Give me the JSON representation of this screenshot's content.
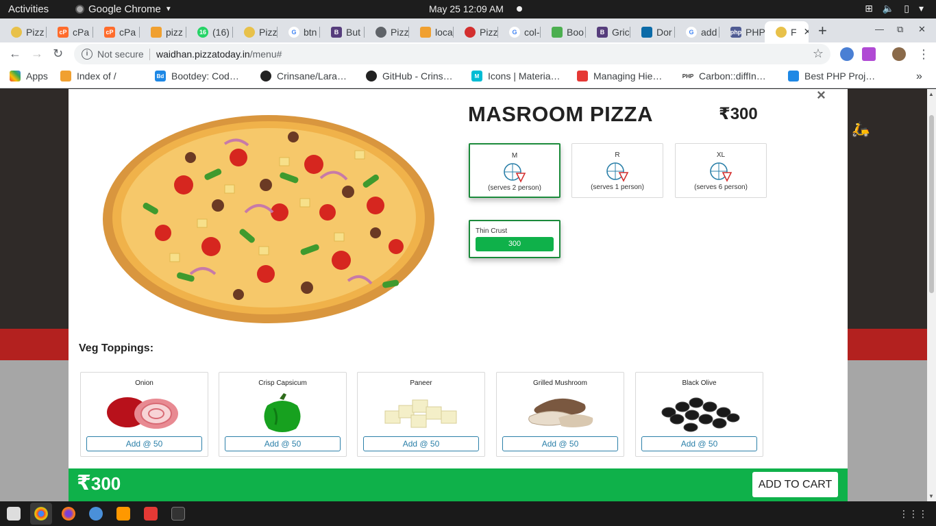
{
  "topbar": {
    "activities": "Activities",
    "app_name": "Google Chrome",
    "clock": "May 25  12:09 AM"
  },
  "tabs": [
    {
      "label": "Pizz",
      "fav": "pizza"
    },
    {
      "label": "cPa",
      "fav": "cpanel"
    },
    {
      "label": "cPa",
      "fav": "cpanel"
    },
    {
      "label": "pizz",
      "fav": "pma"
    },
    {
      "label": "(16)",
      "fav": "whatsapp"
    },
    {
      "label": "Pizz",
      "fav": "pizza"
    },
    {
      "label": "btn",
      "fav": "google"
    },
    {
      "label": "But",
      "fav": "bootstrap"
    },
    {
      "label": "Pizz",
      "fav": "globe"
    },
    {
      "label": "loca",
      "fav": "pma"
    },
    {
      "label": "Pizz",
      "fav": "pizza-red"
    },
    {
      "label": "col-",
      "fav": "google"
    },
    {
      "label": "Boo",
      "fav": "bootdey"
    },
    {
      "label": "Gric",
      "fav": "bootstrap"
    },
    {
      "label": "Dor",
      "fav": "dominos"
    },
    {
      "label": "add",
      "fav": "google"
    },
    {
      "label": "PHP",
      "fav": "php"
    },
    {
      "label": "F",
      "fav": "pizza"
    }
  ],
  "address": {
    "security": "Not secure",
    "host": "waidhan.pizzatoday.in",
    "path": "/menu#"
  },
  "bookmarks": [
    {
      "label": "Apps"
    },
    {
      "label": "Index of /"
    },
    {
      "label": "Bootdey: Cod…"
    },
    {
      "label": "Crinsane/Lara…"
    },
    {
      "label": "GitHub - Crins…"
    },
    {
      "label": "Icons | Materia…"
    },
    {
      "label": "Managing Hie…"
    },
    {
      "label": "Carbon::diffIn…"
    },
    {
      "label": "Best PHP Proj…"
    }
  ],
  "modal": {
    "title": "MASROOM PIZZA",
    "price": "₹300",
    "close": "×",
    "sizes": [
      {
        "code": "M",
        "serves": "(serves 2 person)",
        "selected": true
      },
      {
        "code": "R",
        "serves": "(serves 1 person)",
        "selected": false
      },
      {
        "code": "XL",
        "serves": "(serves 6 person)",
        "selected": false
      }
    ],
    "crust": {
      "name": "Thin Crust",
      "price": "300"
    },
    "toppings_heading": "Veg Toppings:",
    "toppings": [
      {
        "name": "Onion",
        "button": "Add @ 50"
      },
      {
        "name": "Crisp Capsicum",
        "button": "Add @ 50"
      },
      {
        "name": "Paneer",
        "button": "Add @ 50"
      },
      {
        "name": "Grilled Mushroom",
        "button": "Add @ 50"
      },
      {
        "name": "Black Olive",
        "button": "Add @ 50"
      }
    ],
    "footer": {
      "currency": "₹",
      "total": "300",
      "cart_button": "ADD TO CART"
    }
  },
  "colors": {
    "accent_green": "#0fb14a",
    "selected_border": "#1a8a3a",
    "add_button": "#2a7fa8"
  }
}
